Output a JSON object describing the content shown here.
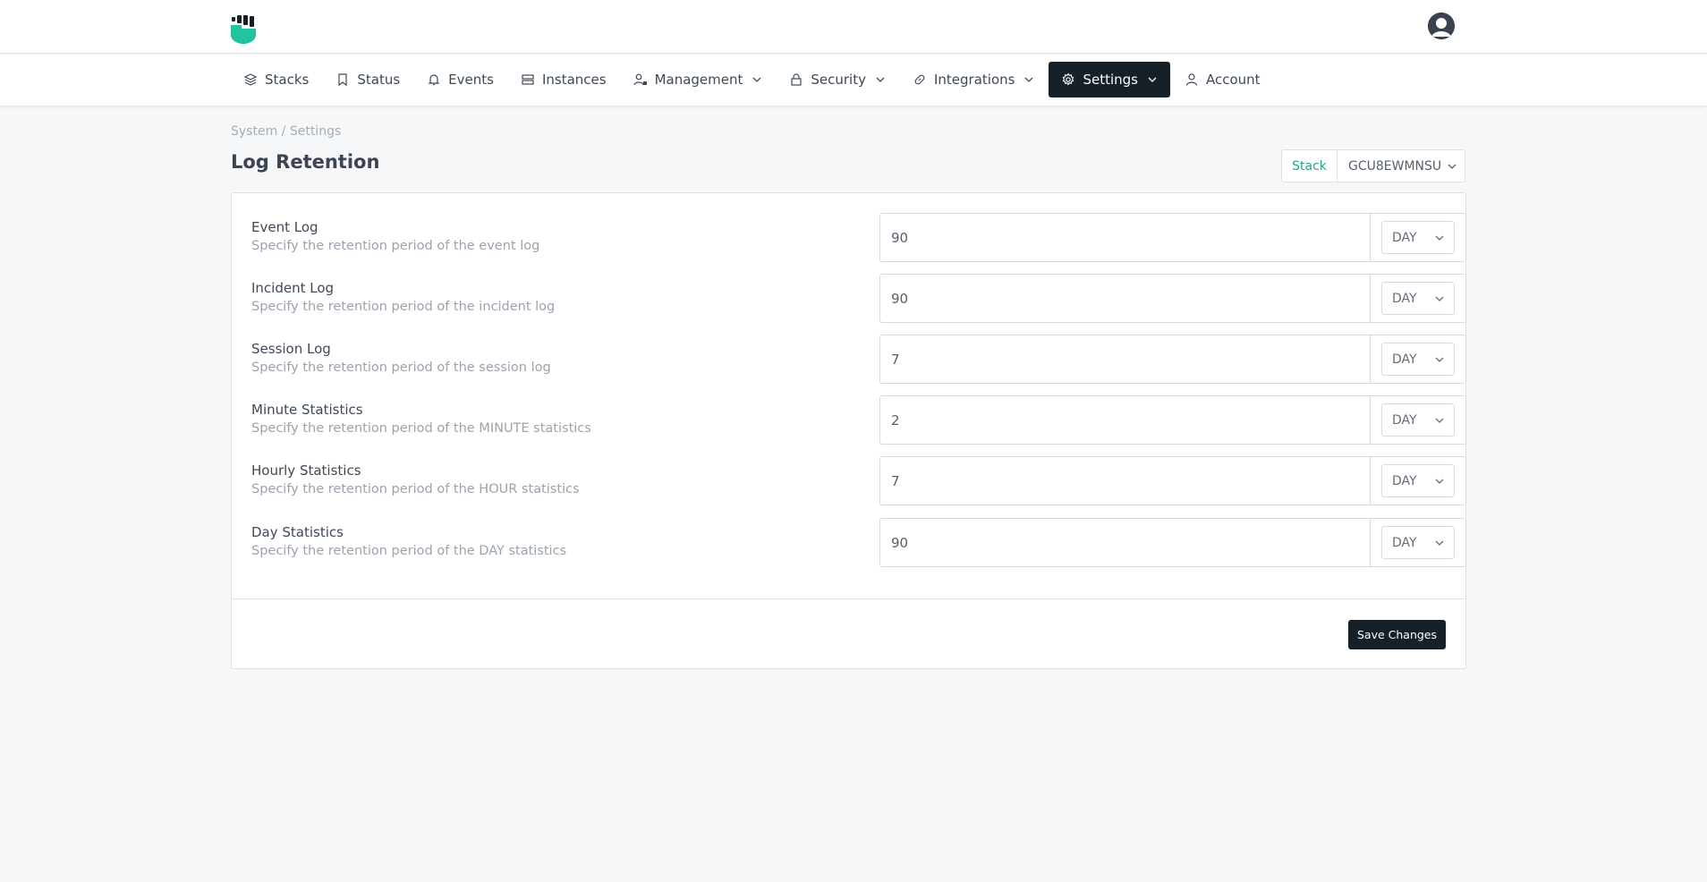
{
  "nav": {
    "items": [
      {
        "label": "Stacks",
        "icon": "layers-icon",
        "has_dropdown": false,
        "active": false
      },
      {
        "label": "Status",
        "icon": "bookmark-icon",
        "has_dropdown": false,
        "active": false
      },
      {
        "label": "Events",
        "icon": "bell-icon",
        "has_dropdown": false,
        "active": false
      },
      {
        "label": "Instances",
        "icon": "server-icon",
        "has_dropdown": false,
        "active": false
      },
      {
        "label": "Management",
        "icon": "user-lock-icon",
        "has_dropdown": true,
        "active": false
      },
      {
        "label": "Security",
        "icon": "lock-icon",
        "has_dropdown": true,
        "active": false
      },
      {
        "label": "Integrations",
        "icon": "link-icon",
        "has_dropdown": true,
        "active": false
      },
      {
        "label": "Settings",
        "icon": "gear-icon",
        "has_dropdown": true,
        "active": true
      },
      {
        "label": "Account",
        "icon": "user-icon",
        "has_dropdown": false,
        "active": false
      }
    ]
  },
  "breadcrumb": "System / Settings",
  "page_title": "Log Retention",
  "stack_selector": {
    "label": "Stack",
    "value": "GCU8EWMNSU"
  },
  "settings": [
    {
      "title": "Event Log",
      "description": "Specify the retention period of the event log",
      "value": "90",
      "unit": "DAY"
    },
    {
      "title": "Incident Log",
      "description": "Specify the retention period of the incident log",
      "value": "90",
      "unit": "DAY"
    },
    {
      "title": "Session Log",
      "description": "Specify the retention period of the session log",
      "value": "7",
      "unit": "DAY"
    },
    {
      "title": "Minute Statistics",
      "description": "Specify the retention period of the MINUTE statistics",
      "value": "2",
      "unit": "DAY"
    },
    {
      "title": "Hourly Statistics",
      "description": "Specify the retention period of the HOUR statistics",
      "value": "7",
      "unit": "DAY"
    },
    {
      "title": "Day Statistics",
      "description": "Specify the retention period of the DAY statistics",
      "value": "90",
      "unit": "DAY"
    }
  ],
  "save_label": "Save Changes",
  "colors": {
    "accent": "#1fa88a",
    "dark": "#162029",
    "page_bg": "#f6f7f9"
  }
}
